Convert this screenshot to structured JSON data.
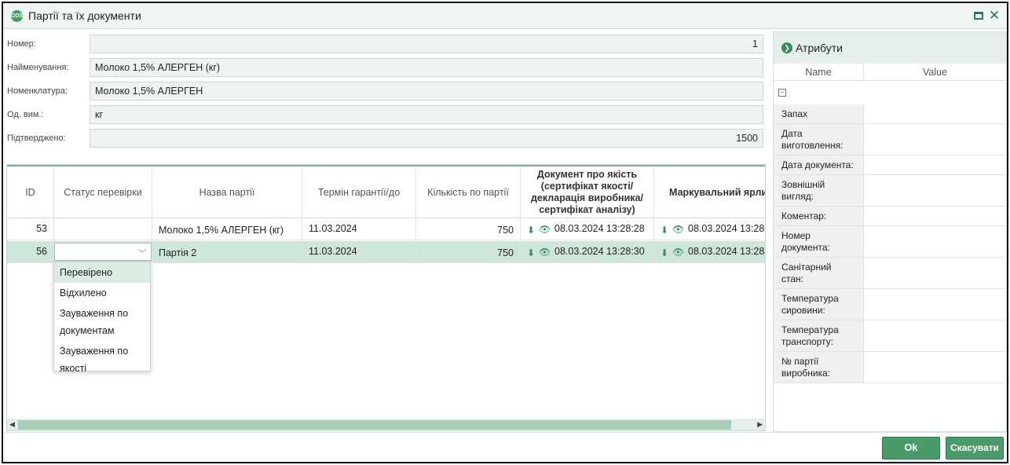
{
  "window": {
    "title": "Партії та їх документи",
    "icon": "app-logo-icon"
  },
  "form": {
    "number_label": "Номер:",
    "number_value": "1",
    "name_label": "Найменування:",
    "name_value": "Молоко 1,5% АЛЕРГЕН (кг)",
    "nomenclature_label": "Номенклатура:",
    "nomenclature_value": "Молоко 1,5% АЛЕРГЕН",
    "unit_label": "Од. вим.:",
    "unit_value": "кг",
    "confirmed_label": "Підтверджено:",
    "confirmed_value": "1500"
  },
  "grid": {
    "columns": [
      "ID",
      "Статус перевірки",
      "Назва партії",
      "Термін гарантії/до",
      "Кількість по партії",
      "Документ про якість (сертифікат якості/ декларація виробника/ сертифікат аналізу)",
      "Маркувальний ярли"
    ],
    "rows": [
      {
        "id": "53",
        "status": "",
        "name": "Молоко 1,5% АЛЕРГЕН (кг)",
        "term": "11.03.2024",
        "qty": "750",
        "doc": "08.03.2024 13:28:28",
        "label": "08.03.2024 13:28"
      },
      {
        "id": "56",
        "status": "",
        "name": "Партія 2",
        "term": "11.03.2024",
        "qty": "750",
        "doc": "08.03.2024 13:28:30",
        "label": "08.03.2024 13:28"
      }
    ]
  },
  "status_dropdown": {
    "options": [
      "Перевірено",
      "Відхилено",
      "Зауваження по документам",
      "Зауваження по якості"
    ],
    "highlighted": "Перевірено"
  },
  "attributes": {
    "title": "Атрибути",
    "name_header": "Name",
    "value_header": "Value",
    "rows": [
      "Запах",
      "Дата виготовлення:",
      "Дата документа:",
      "Зовнішній вигляд:",
      "Коментар:",
      "Номер документа:",
      "Санітарний стан:",
      "Температура сировини:",
      "Температура транспорту:",
      "№ партії виробника:"
    ]
  },
  "footer": {
    "ok_label": "Ok",
    "cancel_label": "Скасувати"
  },
  "colors": {
    "accent": "#4a9a6a",
    "selected_row": "#cfe6da",
    "input_bg": "#eef5f1"
  }
}
